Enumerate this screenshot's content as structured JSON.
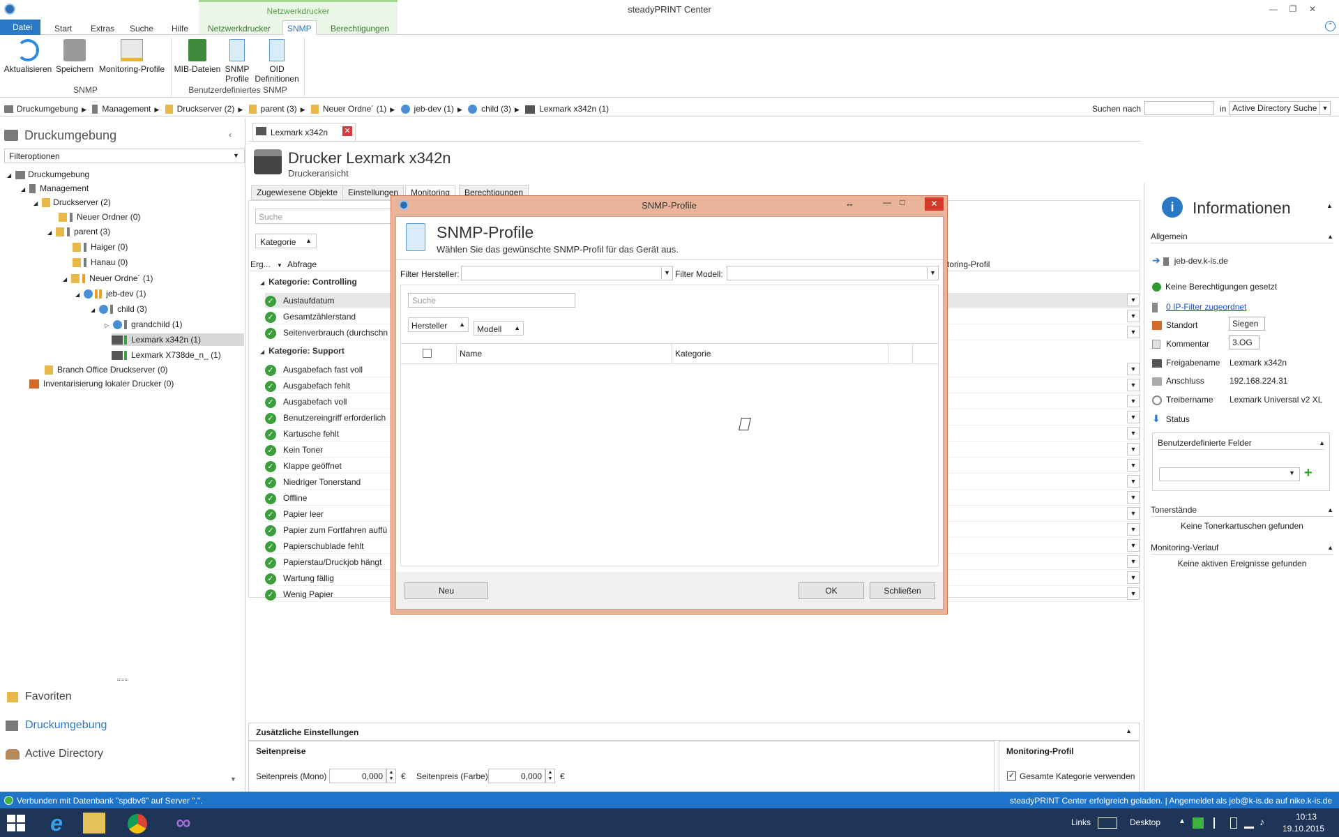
{
  "window": {
    "title": "steadyPRINT Center"
  },
  "ribbon": {
    "tabs": [
      "Start",
      "Extras",
      "Suche",
      "Hilfe",
      "Netzwerkdrucker",
      "SNMP",
      "Berechtigungen"
    ],
    "file_tab": "Datei",
    "context_group": "Netzwerkdrucker",
    "buttons": {
      "refresh": "Aktualisieren",
      "save": "Speichern",
      "monitoring_profiles": "Monitoring-Profile",
      "mib_files": "MIB-Dateien",
      "snmp_profiles_1": "SNMP",
      "snmp_profiles_2": "Profile",
      "oid_1": "OID",
      "oid_2": "Definitionen"
    },
    "groups": {
      "snmp": "SNMP",
      "custom_snmp": "Benutzerdefiniertes SNMP"
    }
  },
  "breadcrumb": [
    "Druckumgebung",
    "Management",
    "Druckserver (2)",
    "parent (3)",
    "Neuer Ordne´ (1)",
    "jeb-dev (1)",
    "child (3)",
    "Lexmark x342n (1)"
  ],
  "search": {
    "label": "Suchen nach",
    "in_label": "in",
    "scope": "Active Directory Suche"
  },
  "left": {
    "title": "Druckumgebung",
    "filter": "Filteroptionen",
    "tree": [
      "Druckumgebung",
      "Management",
      "Druckserver (2)",
      "Neuer Ordner (0)",
      "parent (3)",
      "Haiger (0)",
      "Hanau (0)",
      "Neuer Ordne´ (1)",
      "jeb-dev (1)",
      "child (3)",
      "grandchild (1)",
      "Lexmark x342n (1)",
      "Lexmark X738de_n_ (1)",
      "Branch Office Druckserver (0)",
      "Inventarisierung lokaler Drucker (0)"
    ],
    "nav": [
      "Favoriten",
      "Druckumgebung",
      "Active Directory"
    ]
  },
  "content": {
    "tab": "Lexmark x342n",
    "title": "Drucker Lexmark x342n",
    "subtitle": "Druckeransicht",
    "subtabs": [
      "Zugewiesene Objekte",
      "Einstellungen",
      "Monitoring",
      "Berechtigungen"
    ],
    "search_placeholder": "Suche",
    "group_chip": "Kategorie",
    "col_erg": "Erg...",
    "col_abfrage": "Abfrage",
    "col_profile": "toring-Profil",
    "cat_controlling": "Kategorie: Controlling",
    "controlling": [
      "Auslaufdatum",
      "Gesamtzählerstand",
      "Seitenverbrauch (durchschn"
    ],
    "cat_support": "Kategorie: Support",
    "support": [
      "Ausgabefach fast voll",
      "Ausgabefach fehlt",
      "Ausgabefach voll",
      "Benutzereingriff erforderlich",
      "Kartusche fehlt",
      "Kein Toner",
      "Klappe geöffnet",
      "Niedriger Tonerstand",
      "Offline",
      "Papier leer",
      "Papier zum Fortfahren auffü",
      "Papierschublade fehlt",
      "Papierstau/Druckjob hängt",
      "Wartung fällig",
      "Wenig Papier"
    ]
  },
  "info": {
    "title": "Informationen",
    "general": "Allgemein",
    "host": "jeb-dev.k-is.de",
    "no_permissions": "Keine Berechtigungen gesetzt",
    "ip_filter": "0 IP-Filter zugeordnet",
    "rows": [
      {
        "label": "Standort",
        "value": "Siegen"
      },
      {
        "label": "Kommentar",
        "value": "3.OG"
      },
      {
        "label": "Freigabename",
        "value": "Lexmark x342n"
      },
      {
        "label": "Anschluss",
        "value": "192.168.224.31"
      },
      {
        "label": "Treibername",
        "value": "Lexmark Universal v2 XL"
      },
      {
        "label": "Status",
        "value": ""
      }
    ],
    "custom_fields": "Benutzerdefinierte Felder",
    "toner": "Tonerstände",
    "toner_empty": "Keine Tonerkartuschen gefunden",
    "history": "Monitoring-Verlauf",
    "history_empty": "Keine aktiven Ereignisse gefunden"
  },
  "bottom": {
    "additional": "Zusätzliche Einstellungen",
    "page_prices": "Seitenpreise",
    "mono_label": "Seitenpreis (Mono)",
    "mono_value": "0,000",
    "color_label": "Seitenpreis (Farbe)",
    "color_value": "0,000",
    "currency": "€",
    "monitoring_profile": "Monitoring-Profil",
    "use_category": "Gesamte Kategorie verwenden"
  },
  "modal": {
    "caption": "SNMP-Profile",
    "title": "SNMP-Profile",
    "subtitle": "Wählen Sie das gewünschte SNMP-Profil für das Gerät aus.",
    "filter_vendor": "Filter Hersteller:",
    "filter_model": "Filter Modell:",
    "search_placeholder": "Suche",
    "chip_vendor": "Hersteller",
    "chip_model": "Modell",
    "col_name": "Name",
    "col_category": "Kategorie",
    "btn_new": "Neu",
    "btn_ok": "OK",
    "btn_close": "Schließen"
  },
  "status": {
    "left": "Verbunden mit Datenbank \"spdbv6\" auf Server \".\".",
    "right": "steadyPRINT Center erfolgreich geladen. | Angemeldet als jeb@k-is.de auf nike.k-is.de"
  },
  "taskbar": {
    "links": "Links",
    "desktop": "Desktop",
    "time": "10:13",
    "date": "19.10.2015"
  }
}
